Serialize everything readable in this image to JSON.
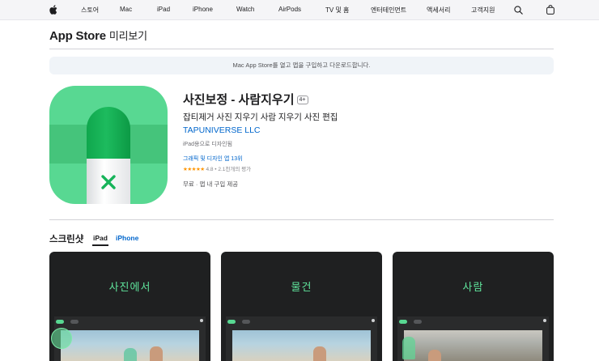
{
  "global_nav": {
    "items": [
      "스토어",
      "Mac",
      "iPad",
      "iPhone",
      "Watch",
      "AirPods",
      "TV 및 홈",
      "엔터테인먼트",
      "액세서리",
      "고객지원"
    ],
    "icons": [
      "apple-logo",
      "search-icon",
      "bag-icon"
    ]
  },
  "subnav": {
    "brand": "App Store",
    "sub": "미리보기"
  },
  "notice": "Mac App Store를 열고 앱을 구입하고 다운로드합니다.",
  "app": {
    "title": "사진보정 - 사람지우기",
    "age_badge": "4+",
    "subtitle": "잡티제거 사진 지우기 사람 지우기 사진 편집",
    "developer": "TAPUNIVERSE LLC",
    "designed_for": "iPad용으로 디자인됨",
    "rank": "그래픽 및 디자인 앱 13위",
    "stars": "★★★★★",
    "rating_text": "4.8 • 2.1천개의 평가",
    "price": "무료 · 앱 내 구입 제공",
    "icon": "eraser-icon",
    "colors": {
      "icon_bg": "#58d892",
      "accent": "#17b45a",
      "link": "#0066cc"
    }
  },
  "screenshots": {
    "title": "스크린샷",
    "tabs": [
      {
        "label": "iPad",
        "active": true
      },
      {
        "label": "iPhone",
        "active": false
      }
    ],
    "items": [
      {
        "caption": "사진에서"
      },
      {
        "caption": "물건"
      },
      {
        "caption": "사람"
      }
    ]
  }
}
